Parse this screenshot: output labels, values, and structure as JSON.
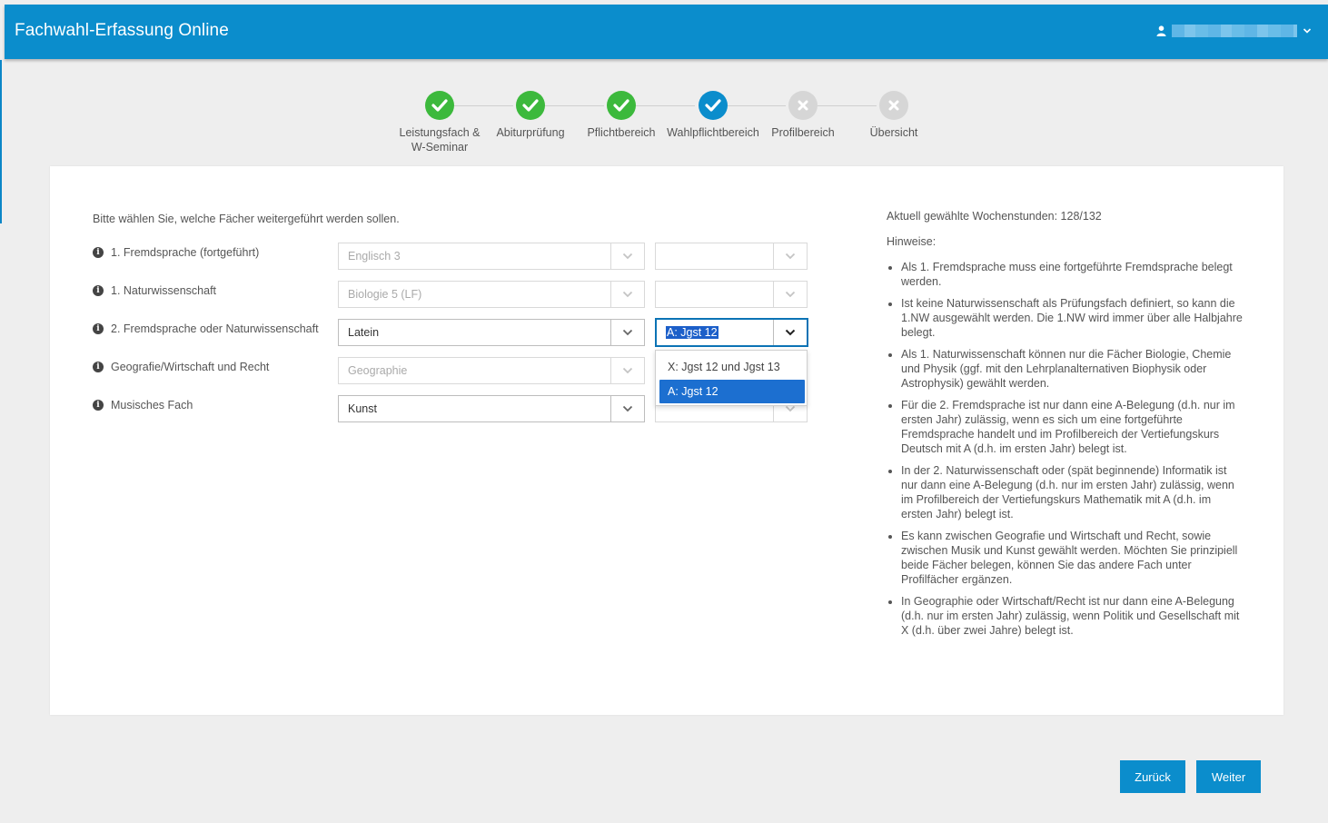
{
  "app": {
    "title": "Fachwahl-Erfassung Online"
  },
  "steps": [
    {
      "label": "Leistungsfach &",
      "label2": "W-Seminar",
      "status": "done"
    },
    {
      "label": "Abiturprüfung",
      "status": "done"
    },
    {
      "label": "Pflichtbereich",
      "status": "done"
    },
    {
      "label": "Wahlpflichtbereich",
      "status": "current"
    },
    {
      "label": "Profilbereich",
      "status": "todo"
    },
    {
      "label": "Übersicht",
      "status": "todo"
    }
  ],
  "form": {
    "intro": "Bitte wählen Sie, welche Fächer weitergeführt werden sollen.",
    "rows": [
      {
        "label": "1. Fremdsprache (fortgeführt)",
        "subject": "Englisch 3",
        "period": ""
      },
      {
        "label": "1. Naturwissenschaft",
        "subject": "Biologie 5 (LF)",
        "period": ""
      },
      {
        "label": "2. Fremdsprache oder Naturwissenschaft",
        "subject": "Latein",
        "period": "A: Jgst 12"
      },
      {
        "label": "Geografie/Wirtschaft und Recht",
        "subject": "Geographie",
        "period": ""
      },
      {
        "label": "Musisches Fach",
        "subject": "Kunst",
        "period": ""
      }
    ],
    "dropdown_options": [
      "X: Jgst 12 und Jgst 13",
      "A: Jgst 12"
    ]
  },
  "sidebar": {
    "hours": "Aktuell gewählte Wochenstunden: 128/132",
    "hints_title": "Hinweise:",
    "hints": [
      "Als 1. Fremdsprache muss eine fortgeführte Fremdsprache belegt werden.",
      "Ist keine Naturwissenschaft als Prüfungsfach definiert, so kann die 1.NW ausgewählt werden. Die 1.NW wird immer über alle Halbjahre belegt.",
      "Als 1. Naturwissenschaft können nur die Fächer Biologie, Chemie und Physik (ggf. mit den Lehrplanalternativen Biophysik oder Astrophysik) gewählt werden.",
      "Für die 2. Fremdsprache ist nur dann eine A-Belegung (d.h. nur im ersten Jahr) zulässig, wenn es sich um eine fortgeführte Fremdsprache handelt und im Profilbereich der Vertiefungskurs Deutsch mit A (d.h. im ersten Jahr) belegt ist.",
      "In der 2. Naturwissenschaft oder (spät beginnende) Informatik ist nur dann eine A-Belegung (d.h. nur im ersten Jahr) zulässig, wenn im Profilbereich der Vertiefungskurs Mathematik mit A (d.h. im ersten Jahr) belegt ist.",
      "Es kann zwischen Geografie und Wirtschaft und Recht, sowie zwischen Musik und Kunst gewählt werden. Möchten Sie prinzipiell beide Fächer belegen, können Sie das andere Fach unter Profilfächer ergänzen.",
      "In Geographie oder Wirtschaft/Recht ist nur dann eine A-Belegung (d.h. nur im ersten Jahr) zulässig, wenn Politik und Gesellschaft mit X (d.h. über zwei Jahre) belegt ist."
    ]
  },
  "buttons": {
    "back": "Zurück",
    "next": "Weiter"
  }
}
